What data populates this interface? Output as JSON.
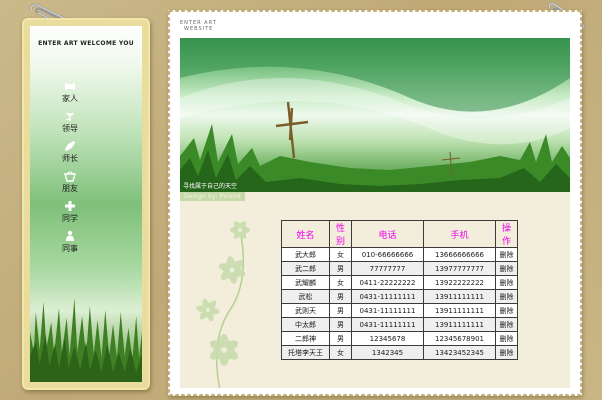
{
  "sidebar": {
    "title": "ENTER ART  WELCOME YOU",
    "items": [
      {
        "label": "家人",
        "icon": "sofa-icon"
      },
      {
        "label": "领导",
        "icon": "tulip-icon"
      },
      {
        "label": "师长",
        "icon": "leaf-icon"
      },
      {
        "label": "朋友",
        "icon": "basket-icon"
      },
      {
        "label": "同学",
        "icon": "plus-icon"
      },
      {
        "label": "同事",
        "icon": "person-icon"
      }
    ]
  },
  "brand": {
    "line1": "ENTER ART",
    "line2": "WEBSITE"
  },
  "banner": {
    "caption": "寻找属于自己的天空"
  },
  "content": {
    "tag": "Design by: Poland"
  },
  "table": {
    "headers": [
      "姓名",
      "性别",
      "电话",
      "手机",
      "操作"
    ],
    "rows": [
      [
        "武大郎",
        "女",
        "010-66666666",
        "13666666666",
        "删除"
      ],
      [
        "武二郎",
        "男",
        "77777777",
        "13977777777",
        "删除"
      ],
      [
        "武耀麟",
        "女",
        "0411-22222222",
        "13922222222",
        "删除"
      ],
      [
        "武松",
        "男",
        "0431-11111111",
        "13911111111",
        "删除"
      ],
      [
        "武则天",
        "男",
        "0431-11111111",
        "13911111111",
        "删除"
      ],
      [
        "中太郎",
        "男",
        "0431-11111111",
        "13911111111",
        "删除"
      ],
      [
        "二郎神",
        "男",
        "12345678",
        "12345678901",
        "删除"
      ],
      [
        "托塔李天王",
        "女",
        "1342345",
        "13423452345",
        "删除"
      ]
    ]
  },
  "colors": {
    "header_text": "#ee00ee",
    "background": "#c4b07e",
    "content_bg": "#f2eedb"
  }
}
